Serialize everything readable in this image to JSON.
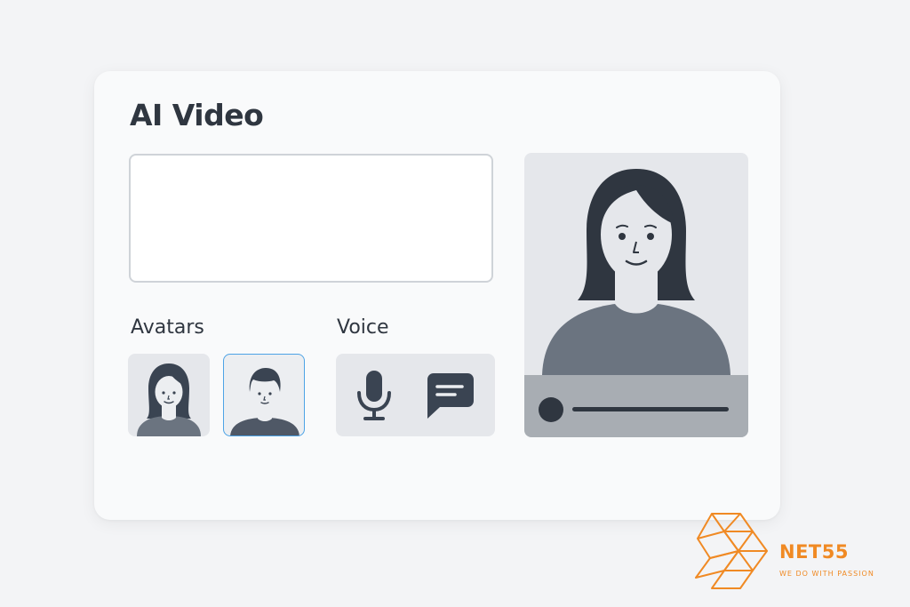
{
  "app": {
    "title": "AI Video"
  },
  "prompt": {
    "value": "",
    "placeholder": ""
  },
  "avatars": {
    "label": "Avatars",
    "items": [
      {
        "name": "female-avatar",
        "selected": false
      },
      {
        "name": "male-avatar",
        "selected": true
      }
    ]
  },
  "voice": {
    "label": "Voice",
    "options": [
      {
        "icon": "microphone-icon"
      },
      {
        "icon": "speech-bubble-icon"
      }
    ]
  },
  "preview": {
    "avatar": "female-avatar",
    "progress": 0
  },
  "brand": {
    "name": "NET55",
    "tagline": "WE DO WITH PASSION"
  },
  "colors": {
    "primary_text": "#2f3640",
    "selected_border": "#4da3e6",
    "brand_orange": "#f08a24",
    "tile_background": "#e5e7eb"
  }
}
